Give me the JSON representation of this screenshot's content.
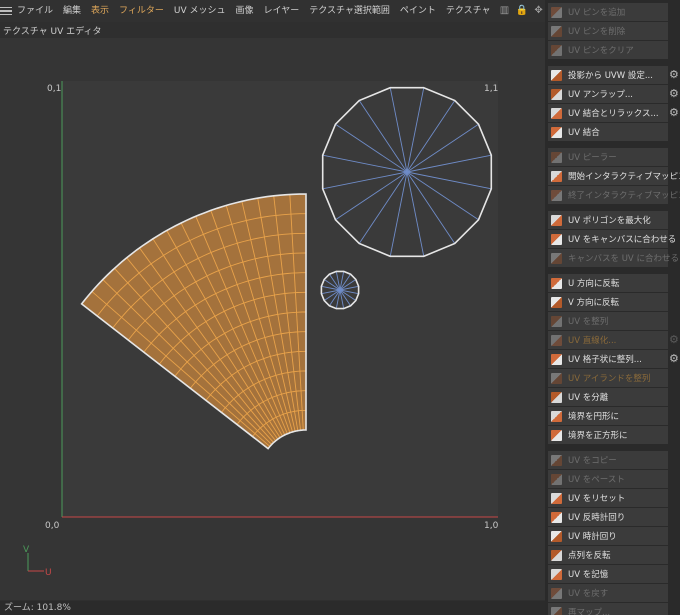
{
  "menu": {
    "items": [
      {
        "label": "ファイル",
        "accent": false
      },
      {
        "label": "編集",
        "accent": false
      },
      {
        "label": "表示",
        "accent": true
      },
      {
        "label": "フィルター",
        "accent": true
      },
      {
        "label": "UV メッシュ",
        "accent": false
      },
      {
        "label": "画像",
        "accent": false
      },
      {
        "label": "レイヤー",
        "accent": false
      },
      {
        "label": "テクスチャ選択範囲",
        "accent": false
      },
      {
        "label": "ペイント",
        "accent": false
      },
      {
        "label": "テクスチャ",
        "accent": false
      }
    ],
    "icons": [
      "chart-icon",
      "lock-icon",
      "move-icon",
      "pin-icon"
    ]
  },
  "panel": {
    "title": "テクスチャ UV エディタ"
  },
  "viewport": {
    "corner_labels": {
      "top_left": "0,1",
      "top_right": "1,1",
      "bottom_left": "0,0",
      "bottom_right": "1,0"
    },
    "axis": {
      "v": "V",
      "u": "U"
    },
    "colors": {
      "uv_fill": "#a4723c",
      "uv_edge": "#e8a24a",
      "circle_edge": "#6f8cc8",
      "outline": "#e6e6e6",
      "v_axis": "#4c9a5a",
      "u_axis": "#c84848"
    }
  },
  "status": {
    "zoom": "ズーム: 101.8%"
  },
  "sidebar": {
    "groups": [
      [
        {
          "label": "UV ピンを追加",
          "icon": "pin-add-icon",
          "enabled": false,
          "gear": false
        },
        {
          "label": "UV ピンを削除",
          "icon": "pin-remove-icon",
          "enabled": false,
          "gear": false
        },
        {
          "label": "UV ピンをクリア",
          "icon": "pin-clear-icon",
          "enabled": false,
          "gear": false
        }
      ],
      [
        {
          "label": "投影から UVW 設定...",
          "icon": "project-uvw-icon",
          "enabled": true,
          "gear": true
        },
        {
          "label": "UV アンラップ...",
          "icon": "unwrap-icon",
          "enabled": true,
          "gear": true
        },
        {
          "label": "UV 結合とリラックス...",
          "icon": "stitch-relax-icon",
          "enabled": true,
          "gear": true
        },
        {
          "label": "UV 結合",
          "icon": "stitch-icon",
          "enabled": true,
          "gear": false
        }
      ],
      [
        {
          "label": "UV ピーラー",
          "icon": "peeler-icon",
          "enabled": false,
          "gear": false
        },
        {
          "label": "開始インタラクティブマッピング",
          "icon": "start-mapping-icon",
          "enabled": true,
          "gear": false
        },
        {
          "label": "終了インタラクティブマッピング",
          "icon": "end-mapping-icon",
          "enabled": false,
          "gear": false
        }
      ],
      [
        {
          "label": "UV ポリゴンを最大化",
          "icon": "maximize-icon",
          "enabled": true,
          "gear": false
        },
        {
          "label": "UV をキャンバスに合わせる",
          "icon": "fit-canvas-icon",
          "enabled": true,
          "gear": false
        },
        {
          "label": "キャンバスを UV に合わせる",
          "icon": "canvas-fit-icon",
          "enabled": false,
          "gear": false
        }
      ],
      [
        {
          "label": "U 方向に反転",
          "icon": "flip-u-icon",
          "enabled": true,
          "gear": false
        },
        {
          "label": "V 方向に反転",
          "icon": "flip-v-icon",
          "enabled": true,
          "gear": false
        },
        {
          "label": "UV を整列",
          "icon": "align-icon",
          "enabled": false,
          "gear": false
        },
        {
          "label": "UV 直線化...",
          "icon": "straighten-icon",
          "enabled": false,
          "gear": true,
          "dim_orange": true
        },
        {
          "label": "UV 格子状に整列...",
          "icon": "grid-align-icon",
          "enabled": true,
          "gear": true
        },
        {
          "label": "UV アイランドを整列",
          "icon": "island-align-icon",
          "enabled": false,
          "gear": false,
          "dim_orange": true
        },
        {
          "label": "UV を分離",
          "icon": "split-icon",
          "enabled": true,
          "gear": false
        },
        {
          "label": "境界を円形に",
          "icon": "circle-border-icon",
          "enabled": true,
          "gear": false
        },
        {
          "label": "境界を正方形に",
          "icon": "square-border-icon",
          "enabled": true,
          "gear": false
        }
      ],
      [
        {
          "label": "UV をコピー",
          "icon": "copy-icon",
          "enabled": false,
          "gear": false
        },
        {
          "label": "UV をペースト",
          "icon": "paste-icon",
          "enabled": false,
          "gear": false
        },
        {
          "label": "UV をリセット",
          "icon": "reset-icon",
          "enabled": true,
          "gear": false
        },
        {
          "label": "UV 反時計回り",
          "icon": "rotate-ccw-icon",
          "enabled": true,
          "gear": false
        },
        {
          "label": "UV 時計回り",
          "icon": "rotate-cw-icon",
          "enabled": true,
          "gear": false
        },
        {
          "label": "点列を反転",
          "icon": "reverse-points-icon",
          "enabled": true,
          "gear": false
        },
        {
          "label": "UV を記憶",
          "icon": "remember-icon",
          "enabled": true,
          "gear": false
        },
        {
          "label": "UV を戻す",
          "icon": "restore-icon",
          "enabled": false,
          "gear": false
        },
        {
          "label": "再マップ...",
          "icon": "remap-icon",
          "enabled": false,
          "gear": false
        }
      ]
    ]
  }
}
